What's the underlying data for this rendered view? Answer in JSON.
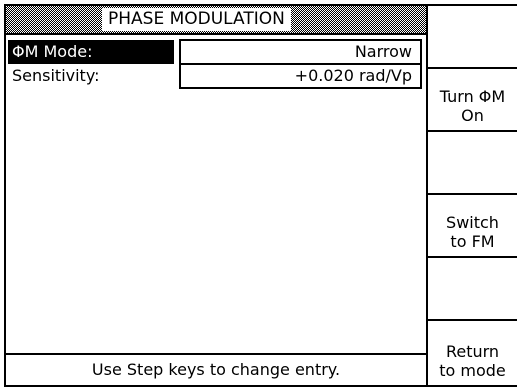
{
  "panel": {
    "title": "PHASE MODULATION",
    "rows": [
      {
        "label": "ΦM Mode:",
        "value": "Narrow"
      },
      {
        "label": "Sensitivity:",
        "value": "+0.020 rad/Vp"
      }
    ],
    "status": "Use Step keys to change entry."
  },
  "softkeys": [
    {
      "line1": "",
      "line2": ""
    },
    {
      "line1": "Turn ΦM",
      "line2": "On"
    },
    {
      "line1": "",
      "line2": ""
    },
    {
      "line1": "Switch",
      "line2": "to FM"
    },
    {
      "line1": "",
      "line2": ""
    },
    {
      "line1": "Return",
      "line2": "to mode"
    }
  ]
}
